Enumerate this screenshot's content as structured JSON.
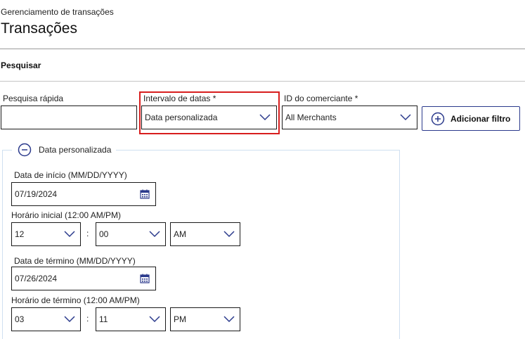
{
  "header": {
    "breadcrumb": "Gerenciamento de transações",
    "title": "Transações"
  },
  "search": {
    "section_title": "Pesquisar",
    "quick_search": {
      "label": "Pesquisa rápida",
      "value": ""
    },
    "date_range": {
      "label": "Intervalo de datas *",
      "value": "Data personalizada"
    },
    "merchant_id": {
      "label": "ID do comerciante *",
      "value": "All Merchants"
    },
    "add_filter_label": "Adicionar filtro"
  },
  "custom_date": {
    "legend": "Data personalizada",
    "start_date": {
      "label": "Data de início (MM/DD/YYYY)",
      "value": "07/19/2024"
    },
    "start_time": {
      "label": "Horário inicial (12:00 AM/PM)",
      "hour": "12",
      "minute": "00",
      "ampm": "AM"
    },
    "end_date": {
      "label": "Data de término (MM/DD/YYYY)",
      "value": "07/26/2024"
    },
    "end_time": {
      "label": "Horário de término (12:00 AM/PM)",
      "hour": "03",
      "minute": "11",
      "ampm": "PM"
    },
    "separator": ":"
  },
  "colors": {
    "highlight": "#d81e1e",
    "accent": "#2b3a8c",
    "panel_border": "#cfe0f0"
  }
}
